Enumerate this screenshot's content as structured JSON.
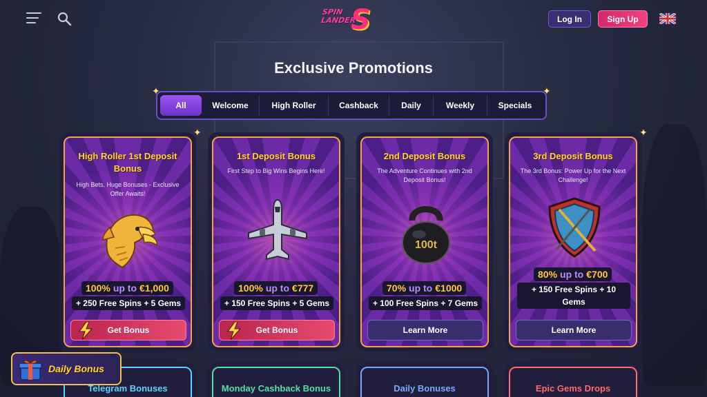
{
  "header": {
    "brand_line1": "SPIN",
    "brand_line2": "LANDER",
    "brand_mark": "S",
    "login_label": "Log In",
    "signup_label": "Sign Up",
    "language_icon": "uk-flag-icon"
  },
  "page": {
    "title": "Exclusive Promotions"
  },
  "tabs": [
    {
      "label": "All",
      "active": true
    },
    {
      "label": "Welcome"
    },
    {
      "label": "High Roller"
    },
    {
      "label": "Cashback"
    },
    {
      "label": "Daily"
    },
    {
      "label": "Weekly"
    },
    {
      "label": "Specials"
    }
  ],
  "cards": [
    {
      "title": "High Roller 1st Deposit Bonus",
      "subtitle": "High Bets, Huge Bonuses - Exclusive Offer Awaits!",
      "art": "eagle",
      "pct": "100%",
      "upto": "up to",
      "amount": "€1,000",
      "extra": "+ 250 Free Spins + 5 Gems",
      "button": "Get Bonus"
    },
    {
      "title": "1st Deposit Bonus",
      "subtitle": "First Step to Big Wins Begins Here!",
      "art": "airplane",
      "pct": "100%",
      "upto": "up to",
      "amount": "€777",
      "extra": "+ 150 Free Spins + 5 Gems",
      "button": "Get Bonus"
    },
    {
      "title": "2nd Deposit Bonus",
      "subtitle": "The Adventure Continues with 2nd Deposit Bonus!",
      "art": "kettlebell",
      "art_label": "100t",
      "pct": "70%",
      "upto": "up to",
      "amount": "€1000",
      "extra": "+ 100 Free Spins + 7 Gems",
      "button": "Learn More"
    },
    {
      "title": "3rd Deposit Bonus",
      "subtitle": "The 3rd Bonus: Power Up for the Next Challenge!",
      "art": "shield",
      "pct": "80%",
      "upto": "up to",
      "amount": "€700",
      "extra": "+ 150 Free Spins + 10 Gems",
      "button": "Learn More"
    }
  ],
  "bottom_cards": [
    {
      "title": "Telegram Bonuses",
      "color": "#5fd1ff"
    },
    {
      "title": "Monday Cashback Bonus",
      "color": "#53e0a0"
    },
    {
      "title": "Daily Bonuses",
      "color": "#7aa8ff"
    },
    {
      "title": "Epic Gems Drops",
      "color": "#ff6b6b"
    }
  ],
  "daily_bonus": {
    "label": "Daily Bonus"
  },
  "colors": {
    "accent_purple": "#6c4ec9",
    "accent_pink": "#e84a6e",
    "gold": "#ffd23f",
    "card_border": "#f5a44a"
  }
}
